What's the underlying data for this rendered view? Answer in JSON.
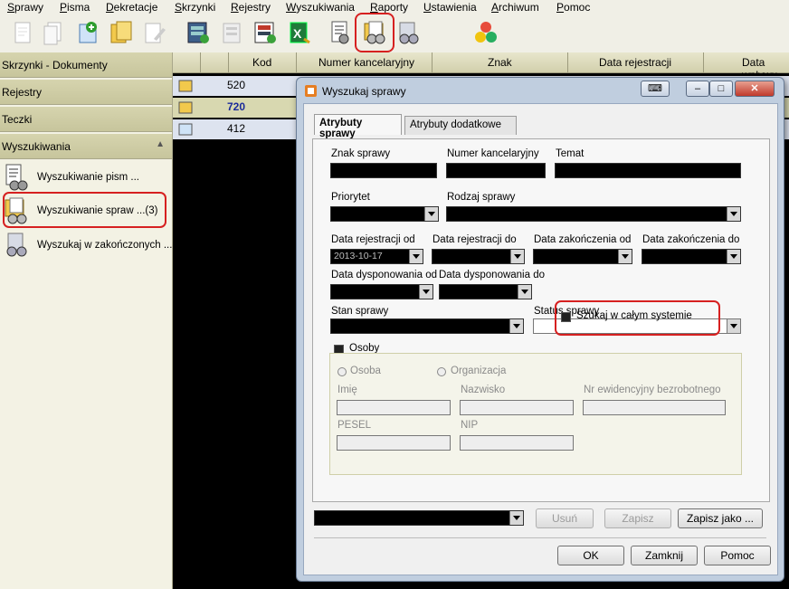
{
  "menu": [
    "Sprawy",
    "Pisma",
    "Dekretacje",
    "Skrzynki",
    "Rejestry",
    "Wyszukiwania",
    "Raporty",
    "Ustawienia",
    "Archiwum",
    "Pomoc"
  ],
  "toolbar": {
    "icons": [
      "new-document-icon",
      "copy-document-icon",
      "add-case-icon",
      "folders-icon",
      "edit-icon",
      "registry-icon",
      "registry-disabled-icon",
      "registry-color-icon",
      "excel-export-icon",
      "search-documents-icon",
      "search-cases-icon",
      "search-closed-icon",
      "groups-icon"
    ]
  },
  "sidebar": {
    "sections": [
      "Skrzynki - Dokumenty",
      "Rejestry",
      "Teczki",
      "Wyszukiwania"
    ],
    "items": [
      {
        "label": "Wyszukiwanie pism ...",
        "icon": "search-documents-icon"
      },
      {
        "label": "Wyszukiwanie spraw ...(3)",
        "icon": "search-cases-icon"
      },
      {
        "label": "Wyszukaj w zakończonych ...",
        "icon": "search-closed-icon"
      }
    ]
  },
  "grid": {
    "columns": [
      "Kod",
      "Numer kancelaryjny",
      "Znak",
      "Data rejestracji",
      "Data wpływu"
    ],
    "rows": [
      {
        "code": "520"
      },
      {
        "code": "720"
      },
      {
        "code": "412"
      }
    ]
  },
  "dialog": {
    "title": "Wyszukaj sprawy",
    "tabs": [
      "Atrybuty sprawy",
      "Atrybuty dodatkowe"
    ],
    "labels": {
      "znak": "Znak sprawy",
      "numer": "Numer kancelaryjny",
      "temat": "Temat",
      "priorytet": "Priorytet",
      "rodzaj": "Rodzaj sprawy",
      "data_rej_od": "Data rejestracji od",
      "data_rej_do": "Data rejestracji do",
      "data_zak_od": "Data zakończenia od",
      "data_zak_do": "Data zakończenia do",
      "data_dysp_od": "Data dysponowania od",
      "data_dysp_do": "Data dysponowania do",
      "szukaj_system": "Szukaj w całym systemie",
      "stan": "Stan sprawy",
      "status": "Status sprawy",
      "osoby": "Osoby",
      "osoba": "Osoba",
      "organizacja": "Organizacja",
      "imie": "Imię",
      "nazwisko": "Nazwisko",
      "nr_ewid": "Nr ewidencyjny bezrobotnego",
      "pesel": "PESEL",
      "nip": "NIP"
    },
    "values": {
      "data_rej_od": "2013-10-17"
    },
    "buttons": {
      "usun": "Usuń",
      "zapisz": "Zapisz",
      "zapisz_jako": "Zapisz jako ...",
      "ok": "OK",
      "zamknij": "Zamknij",
      "pomoc": "Pomoc"
    },
    "window_controls": [
      "minimize-icon",
      "maximize-icon",
      "close-icon"
    ]
  },
  "colors": {
    "highlight": "#d62020",
    "sidebar_header": "#d6d4ae",
    "dialog_frame": "#c0cedf"
  }
}
